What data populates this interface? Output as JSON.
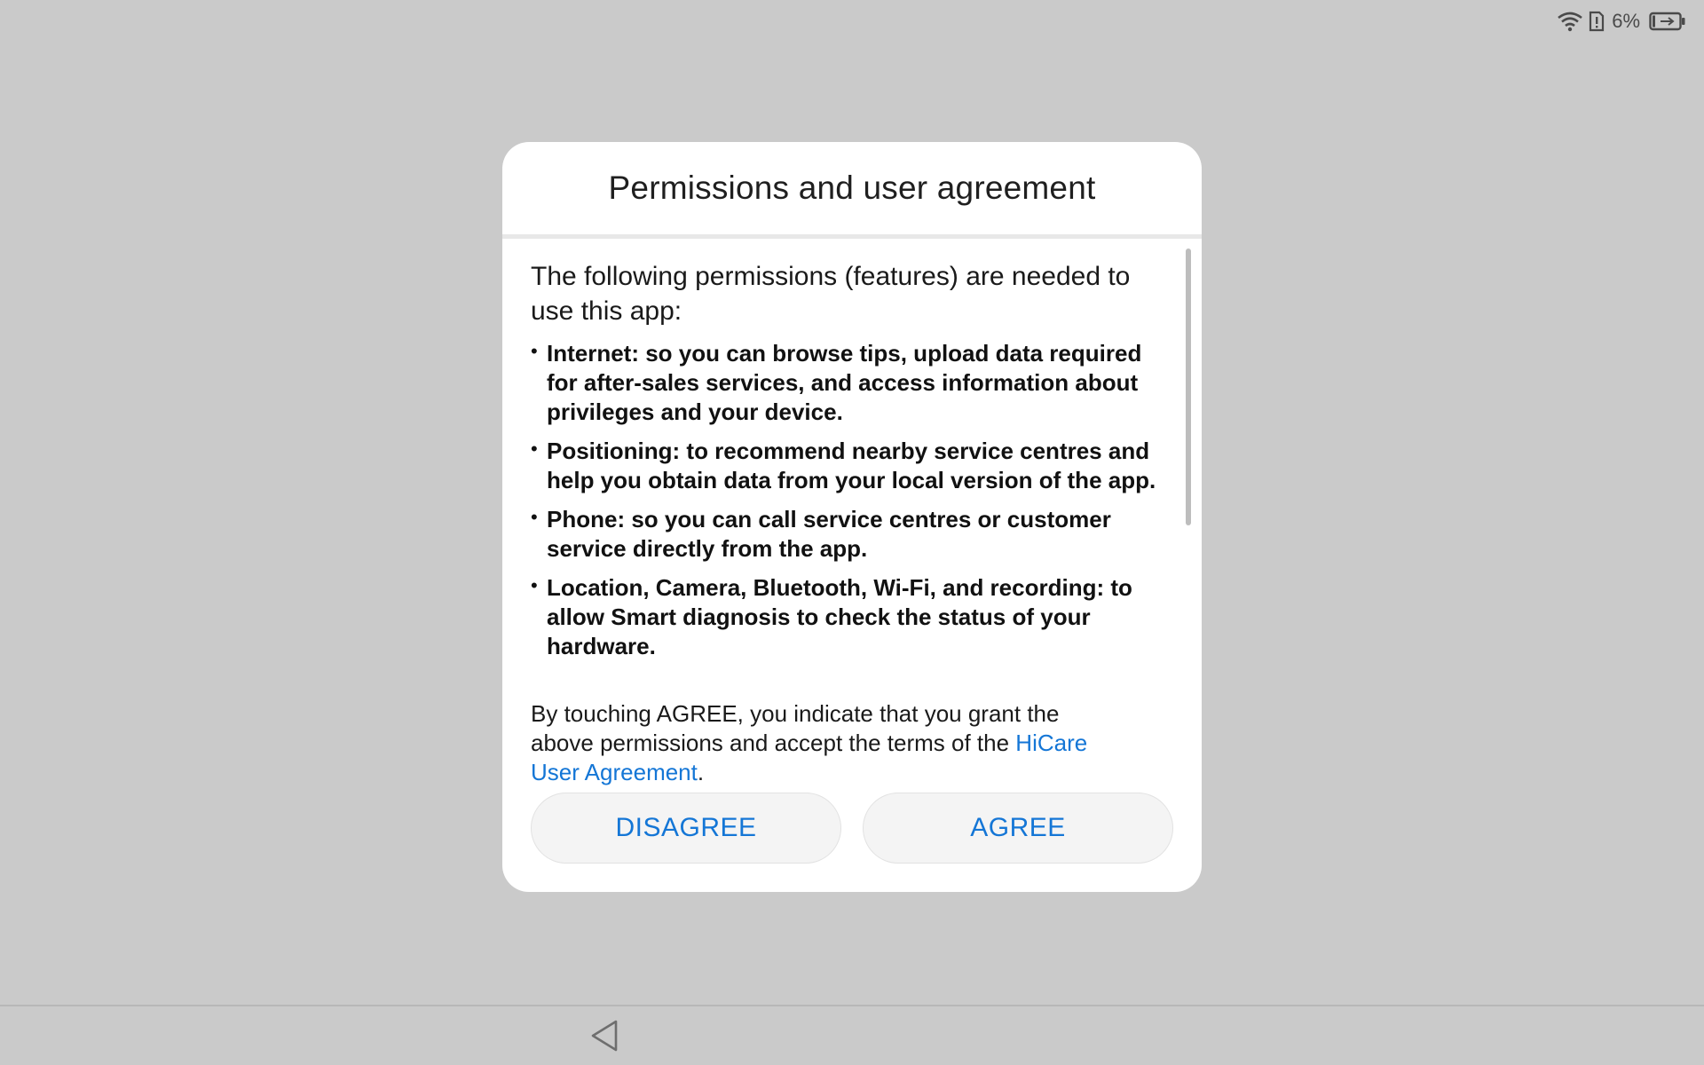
{
  "status_bar": {
    "battery_percent": "6%",
    "icons": [
      "wifi-icon",
      "sim-alert-icon",
      "battery-charging-icon"
    ]
  },
  "dialog": {
    "title": "Permissions and user agreement",
    "intro": "The following permissions (features) are needed to use this app:",
    "bullet_glyph": "•",
    "permissions": [
      "Internet: so you can browse tips, upload data required for after-sales services, and access information about privileges and your device.",
      "Positioning: to recommend nearby service centres and help you obtain data from your local version of the app.",
      "Phone: so you can call service centres or customer service directly from the app.",
      "Location, Camera, Bluetooth, Wi-Fi, and recording: to allow Smart diagnosis to check the status of your hardware."
    ],
    "consent_prefix": "By touching AGREE, you indicate that you grant the above permissions and accept the terms of the ",
    "consent_link": "HiCare User Agreement",
    "consent_suffix": ".",
    "disagree_label": "DISAGREE",
    "agree_label": "AGREE"
  },
  "colors": {
    "accent": "#1476d6",
    "background": "#cacaca",
    "dialog_bg": "#ffffff"
  },
  "nav_bar": {
    "icons": [
      "back-icon"
    ]
  }
}
